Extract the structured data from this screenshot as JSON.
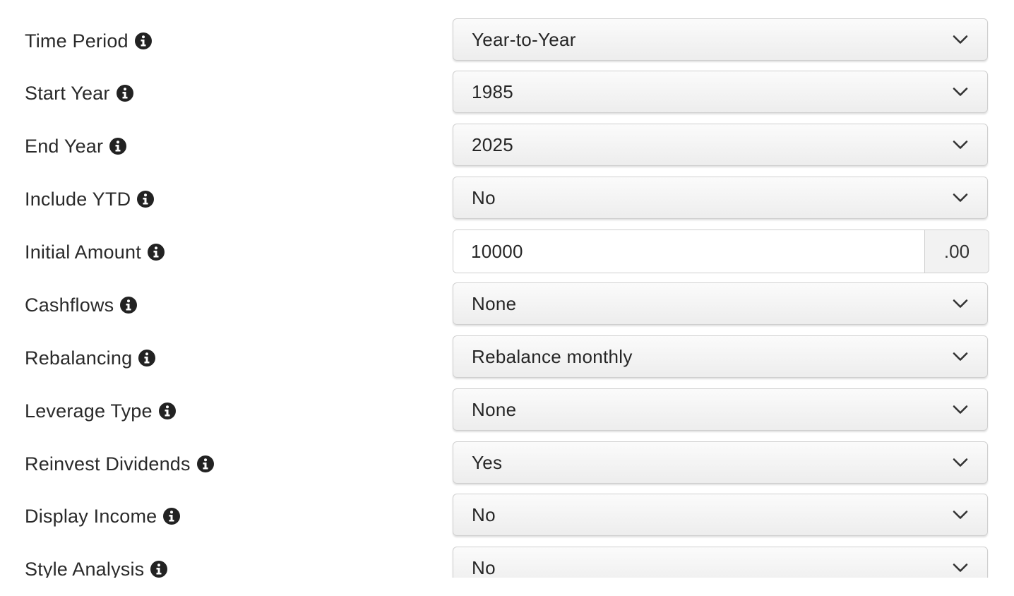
{
  "form": {
    "rows": [
      {
        "label": "Time Period",
        "value": "Year-to-Year"
      },
      {
        "label": "Start Year",
        "value": "1985"
      },
      {
        "label": "End Year",
        "value": "2025"
      },
      {
        "label": "Include YTD",
        "value": "No"
      },
      {
        "label": "Initial Amount",
        "value": "10000",
        "suffix": ".00"
      },
      {
        "label": "Cashflows",
        "value": "None"
      },
      {
        "label": "Rebalancing",
        "value": "Rebalance monthly"
      },
      {
        "label": "Leverage Type",
        "value": "None"
      },
      {
        "label": "Reinvest Dividends",
        "value": "Yes"
      },
      {
        "label": "Display Income",
        "value": "No"
      },
      {
        "label": "Style Analysis",
        "value": "No"
      }
    ]
  },
  "icons": {
    "info": "info-circle-icon",
    "dropdown": "chevron-down-icon"
  },
  "colors": {
    "text": "#2a2a2a",
    "border": "#cfcfcf",
    "select_bg_top": "#fbfbfb",
    "select_bg_bottom": "#ededed",
    "addon_bg": "#f2f2f2"
  }
}
